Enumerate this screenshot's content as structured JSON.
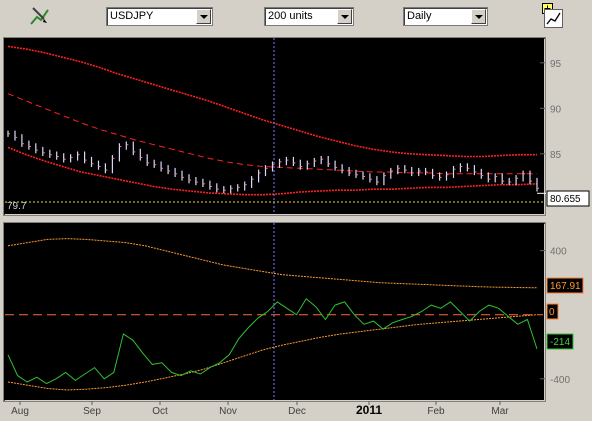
{
  "toolbar": {
    "chart_type_icon": "line-chart-pencil-icon",
    "symbol": "USDJPY",
    "units": "200 units",
    "interval": "Daily",
    "add_icon": "plus-icon",
    "chart_icon": "line-chart-icon"
  },
  "colors": {
    "background": "#000000",
    "band": "#ff2020",
    "indicator": "#30c030",
    "osc_band": "#ff9a30",
    "price_label_bg": "#ffffff",
    "osc_label_bg": "#000000"
  },
  "price_panel": {
    "y_ticks": [
      "95",
      "90",
      "85"
    ],
    "y_tick_values": [
      95,
      90,
      85
    ],
    "low_marker": "79.7",
    "last_price": "80.655"
  },
  "osc_panel": {
    "y_ticks": [
      "400",
      "-400"
    ],
    "y_tick_values": [
      400,
      -400
    ],
    "upper_band_label": "167.91",
    "zero_label": "0",
    "current_label": "-214"
  },
  "x_axis": {
    "labels": [
      "Aug",
      "Sep",
      "Oct",
      "Nov",
      "Dec",
      "2011",
      "Feb",
      "Mar"
    ]
  },
  "chart_data": {
    "type": "line",
    "price": {
      "ylim": [
        78.6,
        97.5
      ],
      "close": [
        87.2,
        86.8,
        86.1,
        85.8,
        85.4,
        85.1,
        84.9,
        84.7,
        84.4,
        84.6,
        84.9,
        84.3,
        83.9,
        83.6,
        83.2,
        84.5,
        85.8,
        86.0,
        85.2,
        84.6,
        84.0,
        83.8,
        83.4,
        83.1,
        82.8,
        82.4,
        82.1,
        81.9,
        81.7,
        81.4,
        81.1,
        81.0,
        81.2,
        81.3,
        81.6,
        82.2,
        82.9,
        83.4,
        83.8,
        84.1,
        84.3,
        84.0,
        83.6,
        83.9,
        84.2,
        84.4,
        83.9,
        83.5,
        83.2,
        82.9,
        82.7,
        82.5,
        82.2,
        81.9,
        82.6,
        83.1,
        83.4,
        83.2,
        82.9,
        83.1,
        83.0,
        82.6,
        82.4,
        82.7,
        83.3,
        83.6,
        83.4,
        83.0,
        82.6,
        82.2,
        82.5,
        82.0,
        81.9,
        82.3,
        82.8,
        82.0,
        81.2
      ],
      "upper_band": [
        96.8,
        96.5,
        96.1,
        95.6,
        95.1,
        94.5,
        93.8,
        93.2,
        92.6,
        92.0,
        91.4,
        90.8,
        90.1,
        89.4,
        88.7,
        88.1,
        87.5,
        86.9,
        86.4,
        85.9,
        85.5,
        85.2,
        85.0,
        84.9,
        84.8,
        84.7,
        84.7,
        84.8,
        84.9,
        84.9
      ],
      "mid_band": [
        91.6,
        90.8,
        90.0,
        89.2,
        88.4,
        87.7,
        87.1,
        86.5,
        86.0,
        85.5,
        85.0,
        84.5,
        84.1,
        83.8,
        83.6,
        83.5,
        83.4,
        83.3,
        83.2,
        83.1,
        83.0,
        83.0,
        82.9,
        82.9,
        82.8,
        82.8,
        82.8,
        82.8,
        82.8,
        82.8
      ],
      "lower_band": [
        85.7,
        84.9,
        84.2,
        83.6,
        83.0,
        82.6,
        82.2,
        81.8,
        81.4,
        81.1,
        80.9,
        80.7,
        80.6,
        80.5,
        80.5,
        80.6,
        80.8,
        80.9,
        81.0,
        81.0,
        81.1,
        81.1,
        81.2,
        81.3,
        81.3,
        81.4,
        81.5,
        81.6,
        81.6,
        81.7
      ]
    },
    "oscillator": {
      "ylim": [
        -520,
        560
      ],
      "upper_band": [
        430,
        450,
        470,
        475,
        470,
        460,
        450,
        430,
        400,
        370,
        340,
        310,
        290,
        270,
        250,
        240,
        230,
        220,
        210,
        200,
        195,
        190,
        185,
        180,
        175,
        172,
        170,
        168
      ],
      "lower_band": [
        -420,
        -440,
        -460,
        -470,
        -465,
        -455,
        -440,
        -420,
        -395,
        -370,
        -340,
        -300,
        -260,
        -220,
        -190,
        -165,
        -140,
        -120,
        -105,
        -90,
        -75,
        -60,
        -50,
        -40,
        -30,
        -20,
        -10,
        0
      ],
      "value": [
        -250,
        -380,
        -420,
        -390,
        -430,
        -400,
        -360,
        -410,
        -370,
        -330,
        -400,
        -360,
        -120,
        -160,
        -240,
        -310,
        -300,
        -360,
        -380,
        -350,
        -370,
        -330,
        -300,
        -250,
        -150,
        -80,
        -20,
        20,
        80,
        40,
        0,
        100,
        50,
        -30,
        60,
        80,
        0,
        -60,
        -40,
        -90,
        -50,
        -30,
        -10,
        20,
        60,
        40,
        80,
        20,
        -40,
        20,
        60,
        40,
        -10,
        -60,
        -30,
        -214
      ]
    }
  }
}
